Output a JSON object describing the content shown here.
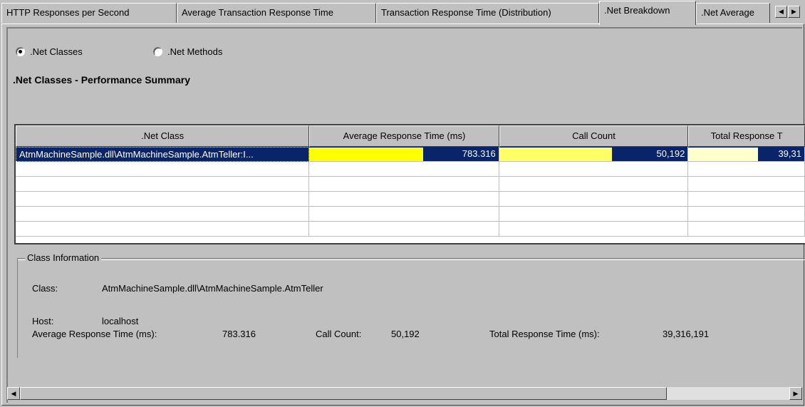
{
  "tabs": [
    {
      "label": "HTTP Responses per Second"
    },
    {
      "label": "Average Transaction Response Time"
    },
    {
      "label": "Transaction Response Time (Distribution)"
    },
    {
      "label": ".Net Breakdown"
    },
    {
      "label": ".Net Average"
    }
  ],
  "active_tab": ".Net Breakdown",
  "view_options": {
    "classes_label": ".Net Classes",
    "methods_label": ".Net Methods",
    "selected": ".Net Classes"
  },
  "summary_title": ".Net Classes - Performance Summary",
  "grid": {
    "columns": [
      ".Net Class",
      "Average Response Time (ms)",
      "Call Count",
      "Total Response T"
    ],
    "rows": [
      {
        "class": "AtmMachineSample.dll\\AtmMachineSample.AtmTeller:I...",
        "avg": "783.316",
        "avg_fill": 1.0,
        "count": "50,192",
        "count_fill": 1.0,
        "total": "39,31",
        "total_fill": 1.0
      }
    ],
    "bar_colors": {
      "avg": "#ffff00",
      "count": "#ffff66",
      "total": "#ffffcc"
    }
  },
  "class_info": {
    "group_title": "Class Information",
    "class_label": "Class:",
    "class_value": "AtmMachineSample.dll\\AtmMachineSample.AtmTeller",
    "host_label": "Host:",
    "host_value": "localhost",
    "avg_label": "Average Response Time (ms):",
    "avg_value": "783.316",
    "count_label": "Call Count:",
    "count_value": "50,192",
    "total_label": "Total Response Time (ms):",
    "total_value": "39,316,191"
  }
}
